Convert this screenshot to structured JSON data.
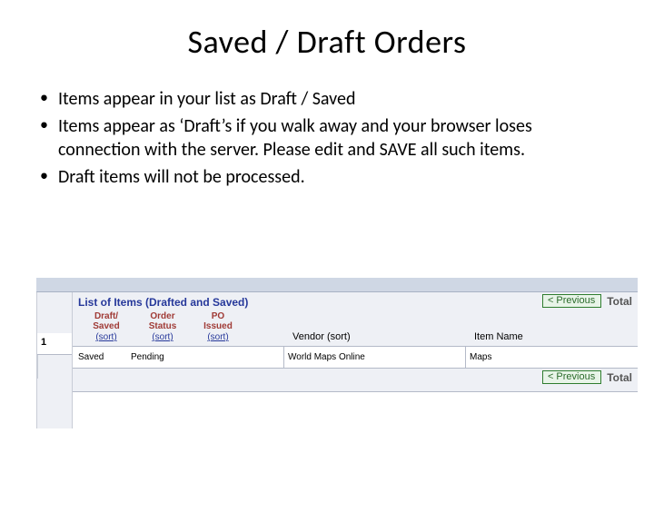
{
  "title": "Saved / Draft Orders",
  "bullets": [
    "Items appear in your list as Draft / Saved",
    "Items appear as ‘Draft’s if you walk away and your browser loses connection with the server. Please edit and SAVE all such items.",
    "Draft items will not be processed."
  ],
  "table": {
    "caption": "List of Items (Drafted and Saved)",
    "prev_btn": "< Previous",
    "total_label": "Total",
    "columns": {
      "draft": {
        "label1": "Draft/",
        "label2": "Saved",
        "sort": "(sort)"
      },
      "order": {
        "label1": "Order",
        "label2": "Status",
        "sort": "(sort)"
      },
      "po": {
        "label1": "PO",
        "label2": "Issued",
        "sort": "(sort)"
      },
      "vendor": {
        "label": "Vendor",
        "sort": "(sort)"
      },
      "item": {
        "label": "Item Name"
      }
    },
    "rows": [
      {
        "num": "1",
        "draft": "Saved",
        "order": "Pending",
        "po": "",
        "vendor": "World Maps Online",
        "item": "Maps"
      }
    ]
  }
}
